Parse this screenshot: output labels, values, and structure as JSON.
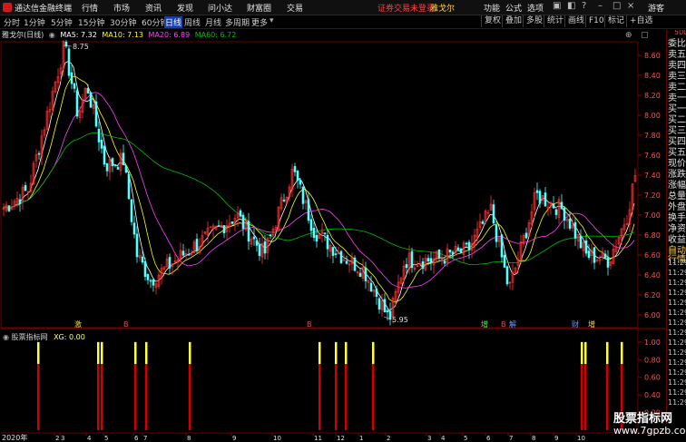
{
  "app": {
    "title": "通达信金融终端"
  },
  "menu": [
    "行情",
    "市场",
    "资讯",
    "发现",
    "问小达",
    "财富圈",
    "交易"
  ],
  "notice": "证券交易未登录",
  "stock_name_top": "雅戈尔",
  "top_right": [
    "功能",
    "公式",
    "选项"
  ],
  "guest": "游客",
  "periods": [
    "分时",
    "1分钟",
    "5分钟",
    "15分钟",
    "30分钟",
    "60分钟",
    "日线",
    "周线",
    "月线",
    "多周期",
    "更多"
  ],
  "active_period": "日线",
  "toolbar_right": [
    "复权",
    "叠加",
    "多股",
    "统计",
    "画线",
    "F10",
    "标记",
    "+自选"
  ],
  "chart_header": {
    "name": "雅戈尔(日线)",
    "ma5": "MA5: 7.32",
    "ma10": "MA10: 7.13",
    "ma20": "MA20: 6.89",
    "ma60": "MA60: 6.72"
  },
  "ma_colors": {
    "ma5": "#ffffff",
    "ma10": "#ffff00",
    "ma20": "#ff40ff",
    "ma60": "#00c000"
  },
  "price_axis": [
    "8.60",
    "8.40",
    "8.20",
    "8.00",
    "7.80",
    "7.60",
    "7.40",
    "7.20",
    "7.00",
    "6.80",
    "6.60",
    "6.40",
    "6.20",
    "6.00"
  ],
  "annotations": {
    "high": "8.75",
    "low": "5.95"
  },
  "event_markers": [
    "激",
    "B",
    "B",
    "增",
    "B",
    "解",
    "财",
    "增"
  ],
  "indicator": {
    "title": "股票指标网",
    "value": "XG: 0.00",
    "axis": [
      "1.00",
      "0.80",
      "0.60",
      "0.40",
      "0.20"
    ]
  },
  "right_panel": {
    "top_small": "500",
    "rows": [
      "委比",
      "卖五",
      "卖四",
      "卖三",
      "卖二",
      "卖一",
      "买一",
      "买二",
      "买三",
      "买四",
      "买五",
      "现价",
      "涨跌",
      "涨幅",
      "总量",
      "外盘",
      "换手",
      "净资",
      "收益",
      "自动",
      "行情",
      "11:29",
      "11:29",
      "11:29",
      "11:29",
      "11:29",
      "11:29",
      "11:29",
      "11:29",
      "11:29",
      "11:29",
      "11:29",
      "11:29",
      "11:29",
      "11:29",
      "11:29"
    ]
  },
  "date_axis": {
    "year": "2020年",
    "months": [
      "2",
      "3",
      "4",
      "5",
      "6",
      "7",
      "8",
      "9",
      "10",
      "11",
      "12",
      "1",
      "2",
      "3",
      "4",
      "5",
      "6",
      "7",
      "8",
      "9",
      "10",
      "11"
    ]
  },
  "watermark": {
    "line1": "股票指标网",
    "line2": "www.7gpzb.com"
  }
}
